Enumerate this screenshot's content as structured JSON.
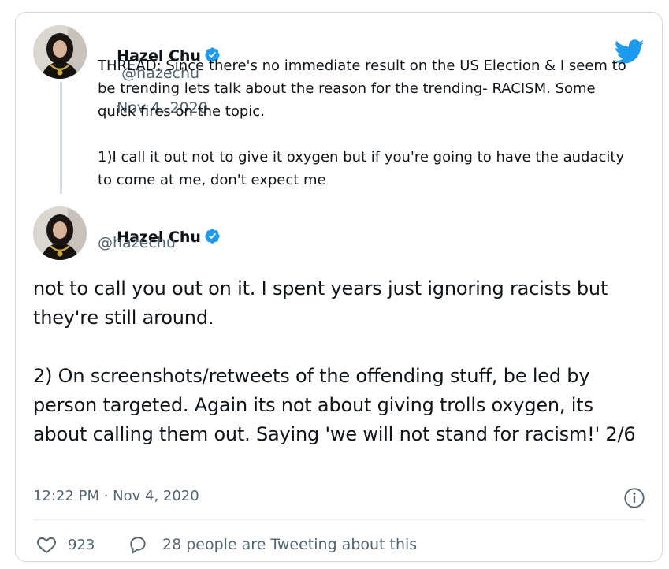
{
  "parent_tweet": {
    "name": "Hazel Chu",
    "handle": "@hazechu",
    "separator": "·",
    "date": "Nov 4, 2020",
    "text": "THREAD: Since there's no immediate result on the US Election & I seem to be trending lets talk about the reason for the trending- RACISM. Some quick fires on the topic.\n\n1)I call it out not to give it oxygen but if you're going to have the audacity to come at me, don't expect me"
  },
  "main_tweet": {
    "name": "Hazel Chu",
    "handle": "@hazechu",
    "text": "not to call you out on it. I spent years just ignoring racists but they're still around.\n\n2) On screenshots/retweets of the offending stuff, be led by person targeted. Again its not about giving trolls oxygen, its about calling them out. Saying 'we will not stand for racism!' 2/6",
    "timestamp": "12:22 PM · Nov 4, 2020",
    "likes": "923",
    "conversation": "28 people are Tweeting about this"
  },
  "icons": {
    "twitter": "twitter-bird-icon",
    "verified": "verified-badge-icon",
    "info": "info-icon",
    "like": "heart-icon",
    "reply": "speech-bubble-icon"
  },
  "colors": {
    "twitter_blue": "#1d9bf0",
    "text": "#0f1419",
    "muted": "#536471",
    "border": "#cfd9de"
  }
}
